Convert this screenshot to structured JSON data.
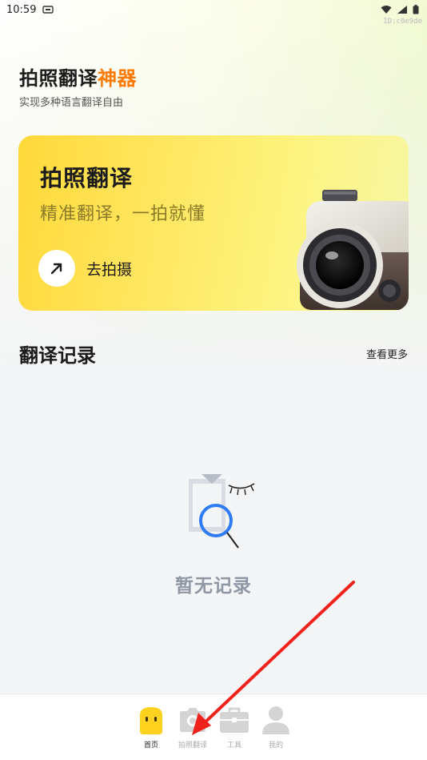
{
  "status_bar": {
    "time": "10:59",
    "device_id": "ID:c0e9de"
  },
  "header": {
    "title_main": "拍照翻译",
    "title_accent": "神器",
    "subtitle": "实现多种语言翻译自由"
  },
  "hero_card": {
    "title": "拍照翻译",
    "subtitle": "精准翻译，一拍就懂",
    "button_label": "去拍摄"
  },
  "history": {
    "title": "翻译记录",
    "see_more": "查看更多",
    "empty_text": "暂无记录"
  },
  "bottom_nav": {
    "items": [
      {
        "label": "首页",
        "icon": "home-icon",
        "active": true
      },
      {
        "label": "拍照翻译",
        "icon": "camera-icon",
        "active": false
      },
      {
        "label": "工具",
        "icon": "toolbox-icon",
        "active": false
      },
      {
        "label": "我的",
        "icon": "profile-icon",
        "active": false
      }
    ]
  },
  "colors": {
    "accent_orange": "#ff7a00",
    "card_yellow": "#ffd93a",
    "nav_active": "#ffd21f",
    "nav_inactive": "#d4d4d4",
    "empty_blue": "#2f7bf5",
    "annotation_red": "#f0221b"
  }
}
